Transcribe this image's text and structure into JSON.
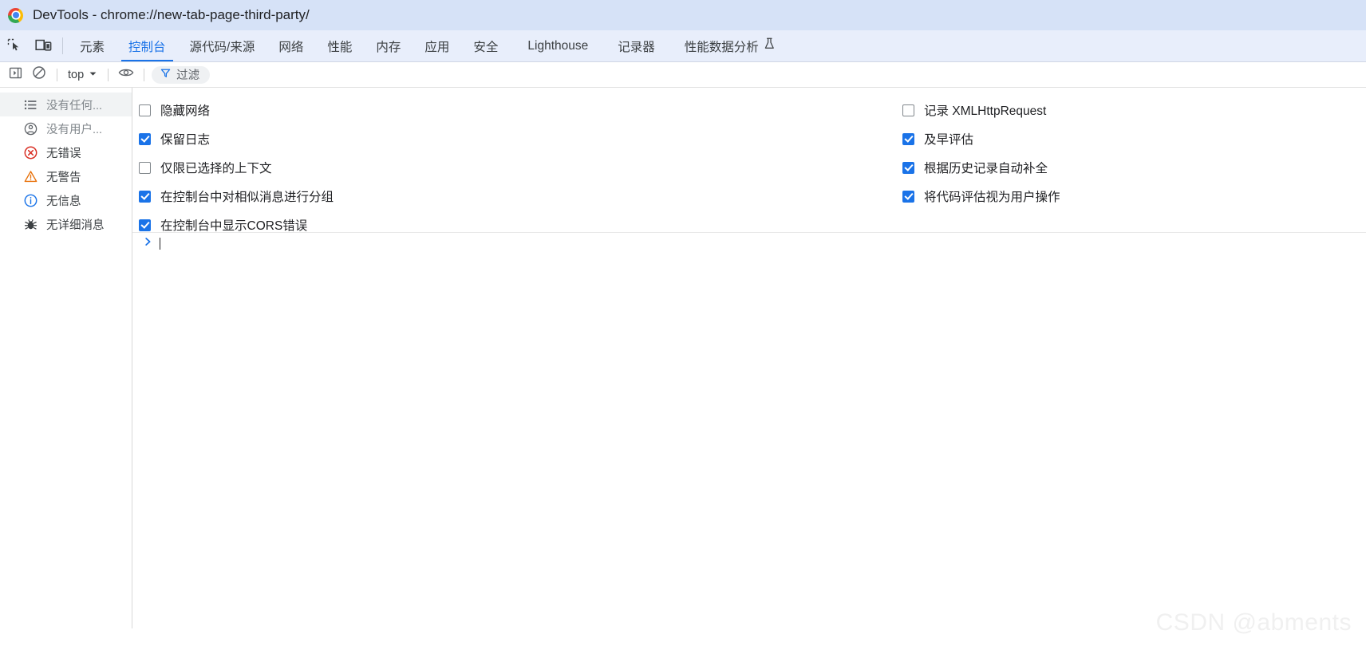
{
  "window": {
    "title": "DevTools - chrome://new-tab-page-third-party/",
    "logo_icon": "chrome-logo-icon"
  },
  "tabstrip": {
    "inspect_icon": "inspect-element-icon",
    "device_icon": "device-toolbar-icon",
    "tabs": [
      {
        "label": "元素",
        "active": false
      },
      {
        "label": "控制台",
        "active": true
      },
      {
        "label": "源代码/来源",
        "active": false
      },
      {
        "label": "网络",
        "active": false
      },
      {
        "label": "性能",
        "active": false
      },
      {
        "label": "内存",
        "active": false
      },
      {
        "label": "应用",
        "active": false
      },
      {
        "label": "安全",
        "active": false
      },
      {
        "label": "Lighthouse",
        "active": false
      },
      {
        "label": "记录器",
        "active": false
      },
      {
        "label": "性能数据分析",
        "active": false,
        "icon": "flask-experiment-icon"
      }
    ]
  },
  "toolbar": {
    "sidebar_toggle_icon": "show-console-sidebar-icon",
    "clear_console_icon": "clear-console-icon",
    "context_value": "top",
    "context_chevron_icon": "chevron-down-icon",
    "eye_icon": "live-expression-eye-icon",
    "filter_icon": "filter-funnel-icon",
    "filter_placeholder": "过滤"
  },
  "sidebar": {
    "items": [
      {
        "label": "没有任何...",
        "icon": "list-messages-icon",
        "selected": true,
        "muted": true
      },
      {
        "label": "没有用户...",
        "icon": "user-message-icon",
        "selected": false,
        "muted": true
      },
      {
        "label": "无错误",
        "icon": "error-circle-icon",
        "selected": false,
        "muted": false
      },
      {
        "label": "无警告",
        "icon": "warning-triangle-icon",
        "selected": false,
        "muted": false
      },
      {
        "label": "无信息",
        "icon": "info-circle-icon",
        "selected": false,
        "muted": false
      },
      {
        "label": "无详细消息",
        "icon": "bug-verbose-icon",
        "selected": false,
        "muted": false
      }
    ]
  },
  "settings": {
    "left_column": [
      {
        "label": "隐藏网络",
        "checked": false
      },
      {
        "label": "保留日志",
        "checked": true
      },
      {
        "label": "仅限已选择的上下文",
        "checked": false
      },
      {
        "label": "在控制台中对相似消息进行分组",
        "checked": true
      },
      {
        "label": "在控制台中显示CORS错误",
        "checked": true
      }
    ],
    "right_column": [
      {
        "label": "记录 XMLHttpRequest",
        "checked": false
      },
      {
        "label": "及早评估",
        "checked": true
      },
      {
        "label": "根据历史记录自动补全",
        "checked": true
      },
      {
        "label": "将代码评估视为用户操作",
        "checked": true
      }
    ]
  },
  "prompt": {
    "caret_icon": "console-prompt-chevron-icon",
    "value": ""
  },
  "watermark": {
    "text": "CSDN @abments"
  },
  "colors": {
    "accent": "#1a73e8",
    "titlebar_bg": "#d6e2f7",
    "tabstrip_bg": "#e8eefb",
    "error": "#d93025",
    "warning": "#e8710a",
    "info": "#1a73e8"
  }
}
